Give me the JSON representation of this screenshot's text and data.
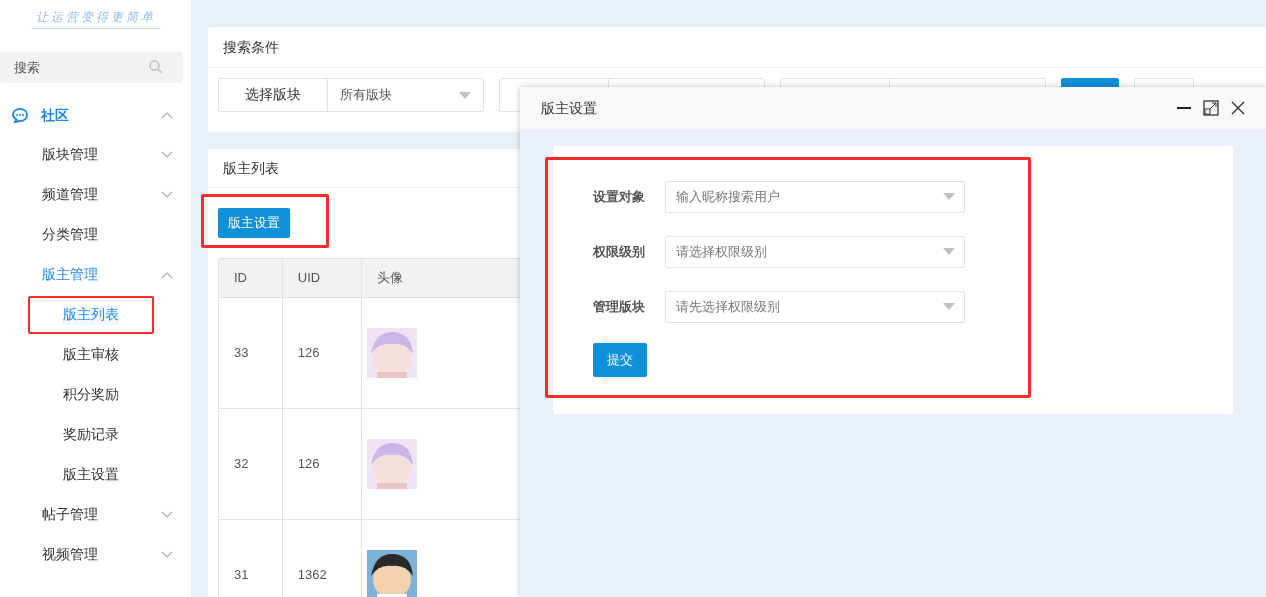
{
  "sidebar": {
    "logo": "让运营变得更简单",
    "search": {
      "placeholder": "搜索"
    },
    "items": [
      {
        "label": "社区",
        "expanded": true,
        "children": [
          {
            "label": "版块管理",
            "expanded": false,
            "selected": false
          },
          {
            "label": "频道管理",
            "expanded": false,
            "selected": false
          },
          {
            "label": "分类管理",
            "selected": false
          },
          {
            "label": "版主管理",
            "expanded": true,
            "selected": false,
            "children": [
              {
                "label": "版主列表",
                "selected": true,
                "highlighted": true
              },
              {
                "label": "版主审核",
                "selected": false,
                "highlighted": false
              },
              {
                "label": "积分奖励",
                "selected": false,
                "highlighted": false
              },
              {
                "label": "奖励记录",
                "selected": false,
                "highlighted": false
              },
              {
                "label": "版主设置",
                "selected": false,
                "highlighted": false
              }
            ]
          },
          {
            "label": "帖子管理",
            "expanded": false,
            "selected": false
          },
          {
            "label": "视频管理",
            "expanded": false,
            "selected": false
          }
        ]
      }
    ]
  },
  "search_panel": {
    "title": "搜索条件",
    "filters": [
      {
        "kind": "select",
        "label": "选择版块",
        "value": "所有版块"
      },
      {
        "kind": "blank"
      },
      {
        "kind": "blank"
      }
    ]
  },
  "list_panel": {
    "title": "版主列表",
    "action_button": {
      "label": "版主设置",
      "highlighted": true
    },
    "table": {
      "columns": [
        "ID",
        "UID",
        "头像"
      ],
      "rows": [
        {
          "id": "33",
          "uid": "126"
        },
        {
          "id": "32",
          "uid": "126"
        },
        {
          "id": "31",
          "uid": "1362"
        }
      ]
    }
  },
  "dialog": {
    "title": "版主设置",
    "form_highlighted": true,
    "fields": [
      {
        "label": "设置对象",
        "placeholder": "输入昵称搜索用户"
      },
      {
        "label": "权限级别",
        "placeholder": "请选择权限级别"
      },
      {
        "label": "管理版块",
        "placeholder": "请先选择权限级别"
      }
    ],
    "submit": "提交"
  }
}
